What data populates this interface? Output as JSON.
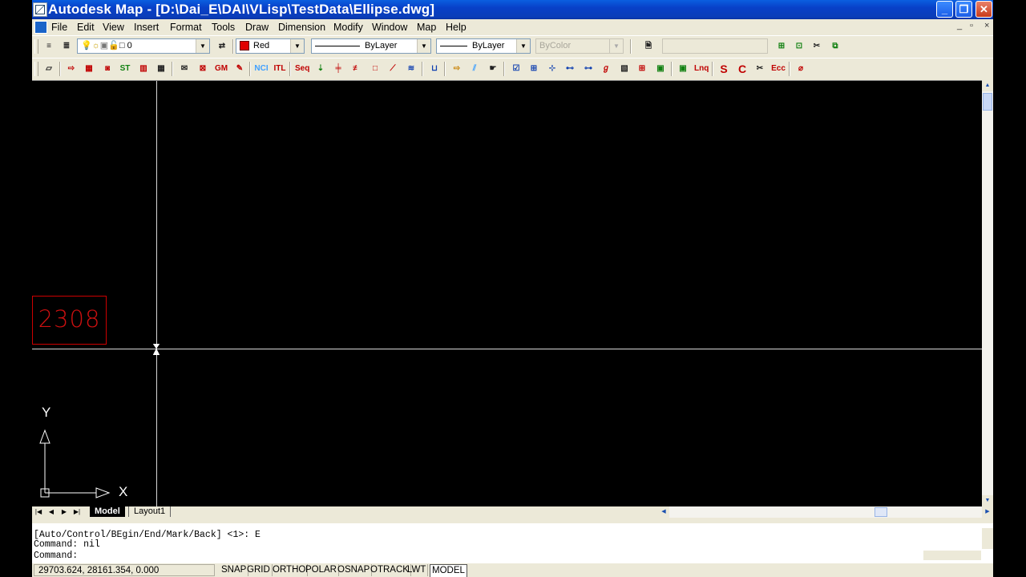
{
  "window": {
    "title": "Autodesk Map - [D:\\Dai_E\\DAI\\VLisp\\TestData\\Ellipse.dwg]",
    "minimize_label": "_",
    "maximize_label": "❐",
    "close_label": "✕"
  },
  "menu": [
    "File",
    "Edit",
    "View",
    "Insert",
    "Format",
    "Tools",
    "Draw",
    "Dimension",
    "Modify",
    "Window",
    "Map",
    "Help"
  ],
  "mdi": {
    "min": "_",
    "restore": "▫",
    "close": "×"
  },
  "properties_toolbar": {
    "layer_value": "0",
    "color_value": "Red",
    "linetype_value": "ByLayer",
    "lineweight_value": "ByLayer",
    "plotstyle_value": "ByColor",
    "url_value": ""
  },
  "map_toolbar_icons": [
    "NCI",
    "ITL",
    "Seq",
    "Ecc",
    "Lnq"
  ],
  "drawing": {
    "label_text": "2308",
    "ucs_y": "Y",
    "ucs_x": "X"
  },
  "tabs": {
    "model": "Model",
    "layout1": "Layout1"
  },
  "command": {
    "line1": "[Auto/Control/BEgin/End/Mark/Back] <1>: E",
    "line2": "Command: nil",
    "line3": "Command:"
  },
  "status": {
    "coordinates": "29703.624, 28161.354, 0.000",
    "buttons": [
      "SNAP",
      "GRID",
      "ORTHO",
      "POLAR",
      "OSNAP",
      "OTRACK",
      "LWT",
      "MODEL"
    ]
  },
  "colors": {
    "title_bar": "#0a46d4",
    "canvas": "#000000",
    "label_red": "#cc1010"
  }
}
